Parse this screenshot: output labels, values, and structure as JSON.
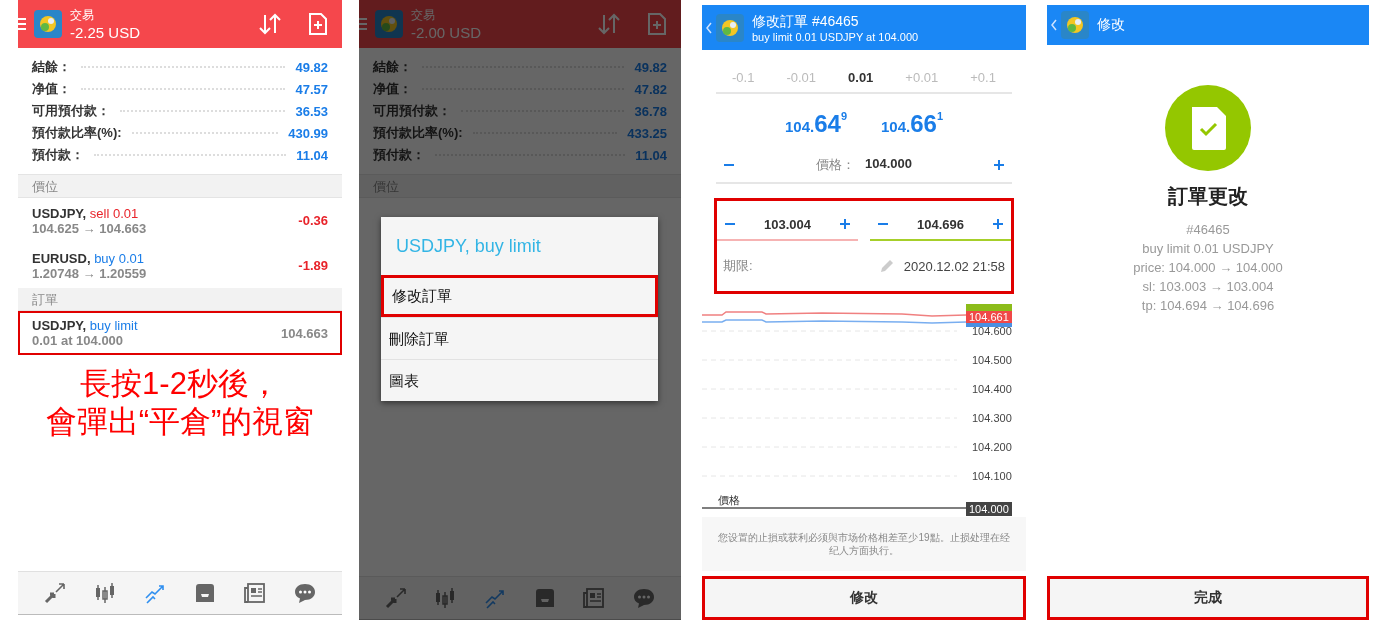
{
  "trade_screen": {
    "header": {
      "title": "交易",
      "balance": "-2.25 USD"
    },
    "account": [
      {
        "label": "結餘：",
        "value": "49.82"
      },
      {
        "label": "净值：",
        "value": "47.57"
      },
      {
        "label": "可用預付款：",
        "value": "36.53"
      },
      {
        "label": "預付款比率(%):",
        "value": "430.99"
      },
      {
        "label": "預付款：",
        "value": "11.04"
      }
    ],
    "sections": [
      {
        "title": "價位",
        "rows": [
          {
            "symbol": "USDJPY,",
            "action": {
              "text": "sell 0.01",
              "kind": "sell"
            },
            "detail": "104.625 → 104.663",
            "value": {
              "text": "-0.36",
              "kind": "loss"
            },
            "highlighted": false
          },
          {
            "symbol": "EURUSD,",
            "action": {
              "text": "buy 0.01",
              "kind": "buy"
            },
            "detail": "1.20748 → 1.20559",
            "value": {
              "text": "-1.89",
              "kind": "loss"
            },
            "highlighted": false
          }
        ]
      },
      {
        "title": "訂單",
        "rows": [
          {
            "symbol": "USDJPY,",
            "action": {
              "text": "buy limit",
              "kind": "buy"
            },
            "detail": "0.01 at 104.000",
            "value": {
              "text": "104.663",
              "kind": "price"
            },
            "highlighted": true
          }
        ]
      }
    ],
    "caption": [
      "長按1-2秒後，",
      "會彈出“平倉”的視窗"
    ],
    "nav": [
      {
        "selected": false
      },
      {
        "selected": false
      },
      {
        "selected": true
      },
      {
        "selected": false
      },
      {
        "selected": false
      },
      {
        "selected": false
      }
    ]
  },
  "dialog_screen": {
    "header": {
      "title": "交易",
      "balance": "-2.00 USD"
    },
    "account": [
      {
        "label": "結餘：",
        "value": "49.82"
      },
      {
        "label": "净值：",
        "value": "47.82"
      },
      {
        "label": "可用預付款：",
        "value": "36.78"
      },
      {
        "label": "預付款比率(%):",
        "value": "433.25"
      },
      {
        "label": "預付款：",
        "value": "11.04"
      }
    ],
    "section_title": "價位",
    "dialog": {
      "title": "USDJPY, buy limit",
      "items": [
        {
          "label": "修改訂單",
          "highlighted": true
        },
        {
          "label": "刪除訂單",
          "highlighted": false
        },
        {
          "label": "圖表",
          "highlighted": false
        }
      ]
    },
    "nav": [
      {
        "selected": false
      },
      {
        "selected": false
      },
      {
        "selected": true
      },
      {
        "selected": false
      },
      {
        "selected": false
      },
      {
        "selected": false
      }
    ]
  },
  "modify_screen": {
    "header": {
      "title": "修改訂單 #46465",
      "subtitle": "buy limit 0.01 USDJPY at 104.000"
    },
    "volume_steps": [
      {
        "label": "-0.1",
        "selected": false
      },
      {
        "label": "-0.01",
        "selected": false
      },
      {
        "label": "0.01",
        "selected": true
      },
      {
        "label": "+0.01",
        "selected": false
      },
      {
        "label": "+0.1",
        "selected": false
      }
    ],
    "quotes": [
      {
        "prefix": "104.",
        "big": "64",
        "sup": "9"
      },
      {
        "prefix": "104.",
        "big": "66",
        "sup": "1"
      }
    ],
    "price": {
      "label": "價格：",
      "value": "104.000"
    },
    "stops": {
      "highlighted": true,
      "fields": [
        {
          "kind": "sl",
          "value": "103.004"
        },
        {
          "kind": "tp",
          "value": "104.696"
        }
      ],
      "expiry_label": "期限:",
      "expiry": "2020.12.02 21:58"
    },
    "chart": {
      "current_tag": "104.661",
      "y_labels": [
        "104.600",
        "104.500",
        "104.400",
        "104.300",
        "104.200",
        "104.100"
      ],
      "line_label": "價格",
      "line_tag": "104.000"
    },
    "note": "您设置的止損或获利必须與市场价格相差至少19點。止损处理在经纪人方面执行。",
    "button": {
      "label": "修改",
      "highlighted": true
    }
  },
  "result_screen": {
    "header": {
      "title": "修改"
    },
    "title": "訂單更改",
    "details": [
      "#46465",
      "buy limit 0.01 USDJPY",
      "price: 104.000 → 104.000",
      "sl: 103.003 → 103.004",
      "tp: 104.694 → 104.696"
    ],
    "button": {
      "label": "完成",
      "highlighted": true
    }
  }
}
